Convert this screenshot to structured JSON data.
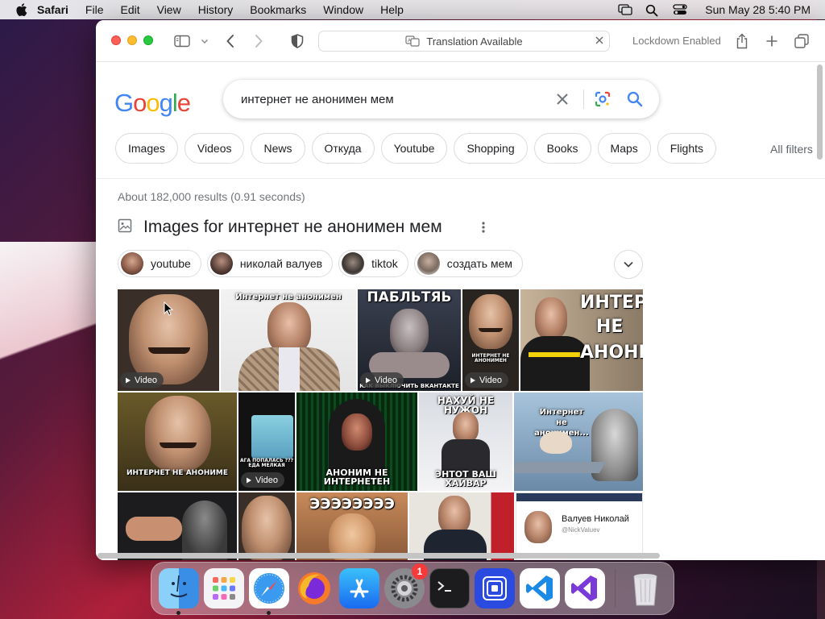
{
  "menubar": {
    "app_name": "Safari",
    "items": [
      "File",
      "Edit",
      "View",
      "History",
      "Bookmarks",
      "Window",
      "Help"
    ],
    "clock": "Sun May 28  5:40 PM"
  },
  "toolbar": {
    "url_text": "Translation Available",
    "lockdown": "Lockdown Enabled"
  },
  "search": {
    "logo": [
      "G",
      "o",
      "o",
      "g",
      "l",
      "e"
    ],
    "logo_colors": [
      "#4285F4",
      "#EA4335",
      "#FBBC05",
      "#4285F4",
      "#34A853",
      "#EA4335"
    ],
    "query": "интернет не анонимен мем",
    "filters": [
      "Images",
      "Videos",
      "News",
      "Откуда",
      "Youtube",
      "Shopping",
      "Books",
      "Maps",
      "Flights"
    ],
    "all_filters": "All filters",
    "stats": "About 182,000 results (0.91 seconds)"
  },
  "images": {
    "title": "Images for интернет не анонимен мем",
    "related": [
      "youtube",
      "николай валуев",
      "tiktok",
      "создать мем"
    ],
    "video_label": "Video",
    "tile_texts": {
      "t2": "Интернет не анонимен",
      "t3_top": "ПАБЛЬТЯЬ",
      "t3_bottom": "КАК ВЫКЛЮЧИТЬ ВКАНТАКТЕ",
      "t4": "ИНТЕРНЕТ НЕ АНОНИМЕН",
      "t5a": "ИНТЕРН",
      "t5b": "НЕ",
      "t5c": "АНОНИ",
      "t6": "ИНТЕРНЕТ НЕ АНОНИМЕ",
      "t7": "АГА ПОПАЛАСЬ ??? ЕДА МЕЛКАЯ",
      "t8": "АНОНИМ НЕ ИНТЕРНЕТЕН",
      "t9_top": "НАХУЙ НЕ НУЖОН",
      "t9_bottom": "ЭНТОТ ВАШ ХАЙВАР",
      "t10": "Интернет не анонимен...",
      "t13": "ЭЭЭЭЭЭЭЭ",
      "t15_name": "Валуев Николай",
      "t15_handle": "@NickValuev"
    }
  },
  "dock": {
    "settings_badge": "1",
    "apps": [
      "finder",
      "launchpad",
      "safari",
      "firefox",
      "app-store",
      "system-settings",
      "terminal",
      "simulator",
      "vscode",
      "visual-studio",
      "trash"
    ]
  }
}
